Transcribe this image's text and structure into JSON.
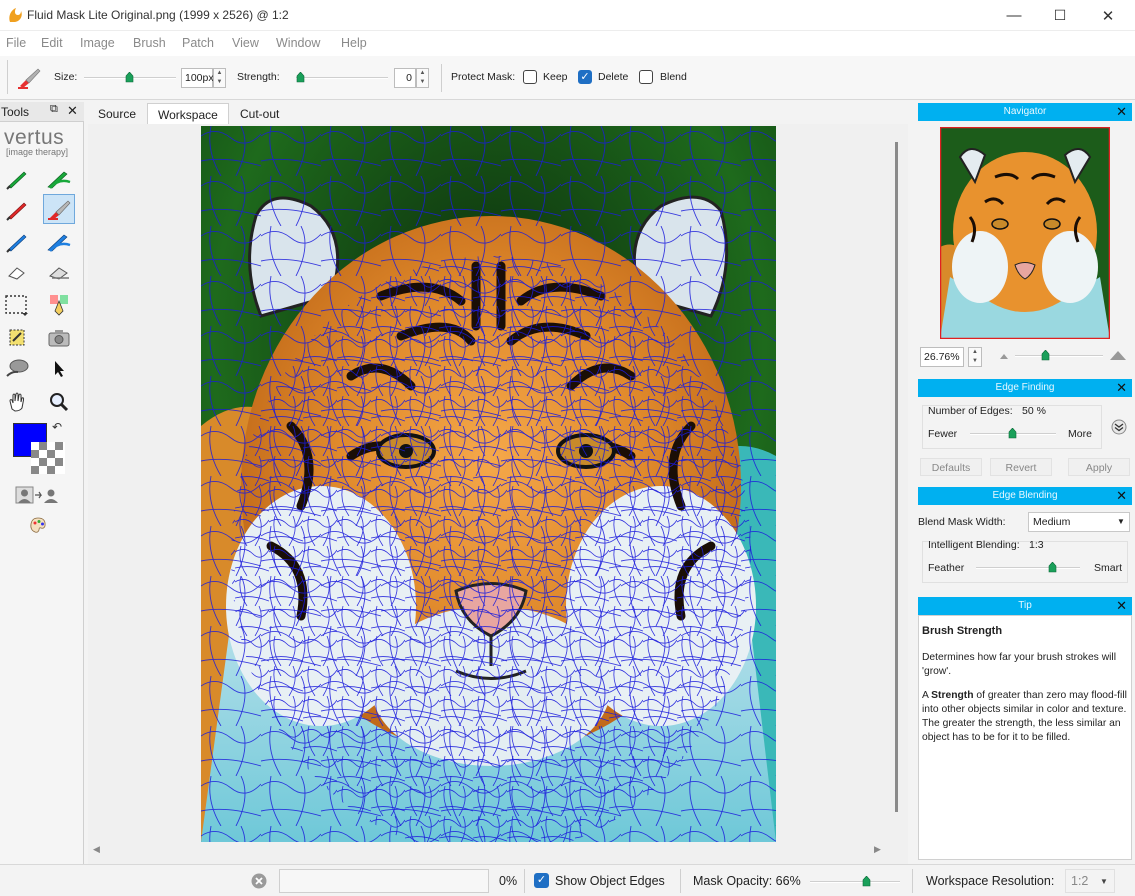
{
  "window": {
    "title": "Fluid Mask Lite  Original.png (1999 x 2526) @ 1:2",
    "minimize": "—",
    "maximize": "☐",
    "close": "✕"
  },
  "menu": [
    "File",
    "Edit",
    "Image",
    "Brush",
    "Patch",
    "View",
    "Window",
    "Help"
  ],
  "toolbar": {
    "size_label": "Size:",
    "size_value": "100px",
    "size_level": 0.5,
    "strength_label": "Strength:",
    "strength_value": "0",
    "strength_level": 0.0,
    "protect_label": "Protect Mask:",
    "keep_label": "Keep",
    "keep_checked": false,
    "delete_label": "Delete",
    "delete_checked": true,
    "blend_label": "Blend",
    "blend_checked": false
  },
  "tools": {
    "title": "Tools",
    "logo": "vertus",
    "logo_sub": "[image therapy]",
    "foreground_color": "#0000ff"
  },
  "tabs": [
    "Source",
    "Workspace",
    "Cut-out"
  ],
  "active_tab": "Workspace",
  "navigator": {
    "title": "Navigator",
    "zoom": "26.76%"
  },
  "edge_finding": {
    "title": "Edge Finding",
    "edges_label": "Number of Edges:",
    "edges_value": "50 %",
    "fewer": "Fewer",
    "more": "More",
    "defaults": "Defaults",
    "revert": "Revert",
    "apply": "Apply"
  },
  "edge_blending": {
    "title": "Edge Blending",
    "width_label": "Blend Mask Width:",
    "width_value": "Medium",
    "intelligent_label": "Intelligent Blending:",
    "intelligent_value": "1:3",
    "feather": "Feather",
    "smart": "Smart"
  },
  "tip": {
    "title": "Tip",
    "heading": "Brush Strength",
    "p1": "Determines how far your brush strokes will 'grow'.",
    "p2_prefix": "A ",
    "p2_bold": "Strength",
    "p2_rest": " of greater than zero may flood-fill into other objects similar in color and texture. The greater the strength, the less similar an object has to be for it to be filled."
  },
  "status": {
    "progress": "0%",
    "show_edges_label": "Show Object Edges",
    "show_edges_checked": true,
    "opacity_label": "Mask Opacity: 66%",
    "resolution_label": "Workspace Resolution:",
    "resolution_value": "1:2"
  },
  "colors": {
    "panel_header": "#00b0f0",
    "edge_lines": "#1a1adc",
    "accent": "#1f6fc4"
  }
}
